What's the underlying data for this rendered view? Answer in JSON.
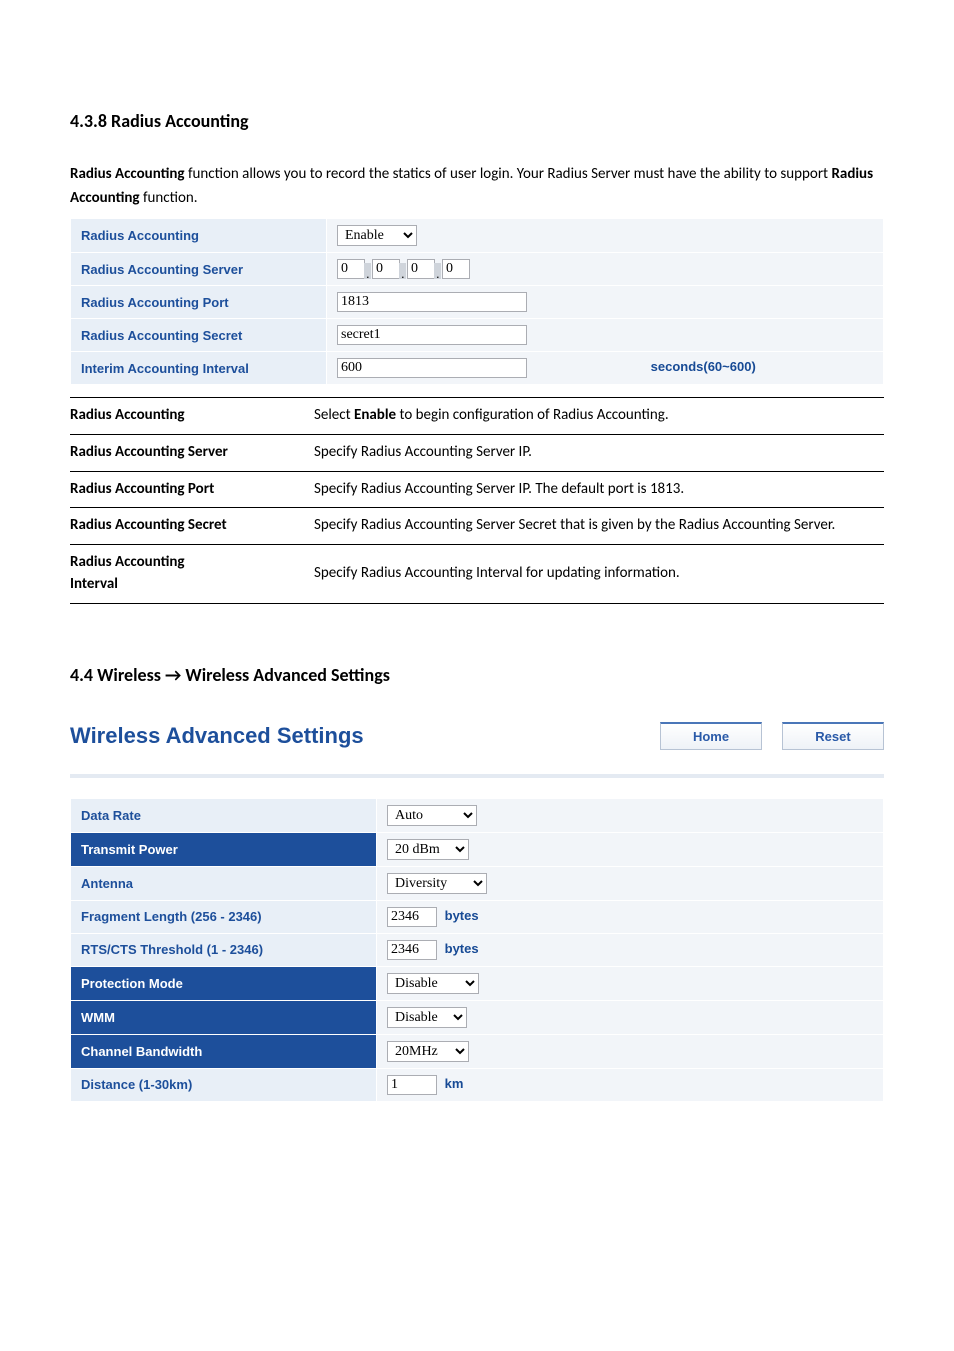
{
  "section_438_title": "4.3.8 Radius Accounting",
  "intro_pre": "Radius Accounting",
  "intro_mid": " function allows you to record the statics of user login. Your Radius Server must have the ability to support ",
  "intro_bold2": "Radius Accounting",
  "intro_post": " function.",
  "radius_form": {
    "row1_label": "Radius Accounting",
    "row1_value": "Enable",
    "row2_label": "Radius Accounting Server",
    "row2_ip": [
      "0",
      "0",
      "0",
      "0"
    ],
    "row3_label": "Radius Accounting Port",
    "row3_value": "1813",
    "row4_label": "Radius Accounting Secret",
    "row4_value": "secret1",
    "row5_label": "Interim Accounting Interval",
    "row5_value": "600",
    "row5_unit": "seconds(60~600)"
  },
  "desc": {
    "r1_l": "Radius Accounting",
    "r1_v_pre": "Select ",
    "r1_v_bold": "Enable",
    "r1_v_post": " to begin configuration of Radius Accounting.",
    "r2_l": "Radius Accounting Server",
    "r2_v": "Specify Radius Accounting Server IP.",
    "r3_l": "Radius Accounting Port",
    "r3_v": "Specify Radius Accounting Server IP. The default port is 1813.",
    "r4_l": "Radius Accounting Secret",
    "r4_v": "Specify Radius Accounting Server Secret that is given by the Radius Accounting Server.",
    "r5_l1": "Radius Accounting",
    "r5_l2": "Interval",
    "r5_v": "Specify Radius Accounting Interval for updating information."
  },
  "section_44_title": "4.4 Wireless → Wireless Advanced Settings",
  "wa_head": {
    "title": "Wireless Advanced Settings",
    "home": "Home",
    "reset": "Reset"
  },
  "wa_form": {
    "r1_l": "Data Rate",
    "r1_v": "Auto",
    "r2_l": "Transmit Power",
    "r2_v": "20 dBm",
    "r3_l": "Antenna",
    "r3_v": "Diversity",
    "r4_l": "Fragment Length (256 - 2346)",
    "r4_v": "2346",
    "r4_u": "bytes",
    "r5_l": "RTS/CTS Threshold (1 - 2346)",
    "r5_v": "2346",
    "r5_u": "bytes",
    "r6_l": "Protection Mode",
    "r6_v": "Disable",
    "r7_l": "WMM",
    "r7_v": "Disable",
    "r8_l": "Channel Bandwidth",
    "r8_v": "20MHz",
    "r9_l": "Distance (1-30km)",
    "r9_v": "1",
    "r9_u": "km"
  }
}
